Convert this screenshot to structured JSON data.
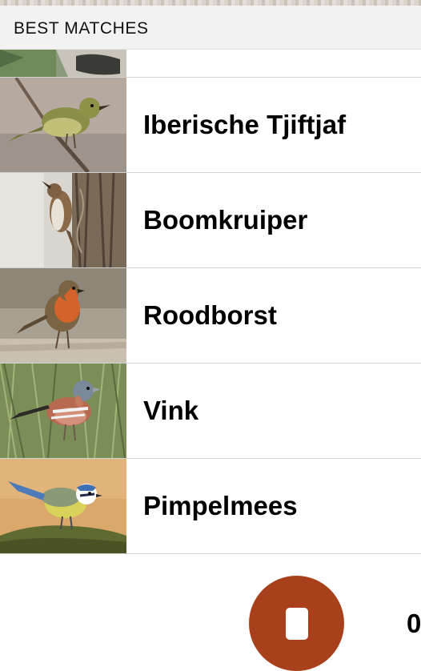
{
  "section_header": {
    "title": "BEST MATCHES"
  },
  "matches": [
    {
      "name": "",
      "photo_icon": "bird-photo-partial"
    },
    {
      "name": "Iberische Tjiftjaf",
      "photo_icon": "iberian-chiffchaff-photo"
    },
    {
      "name": "Boomkruiper",
      "photo_icon": "treecreeper-photo"
    },
    {
      "name": "Roodborst",
      "photo_icon": "robin-photo"
    },
    {
      "name": "Vink",
      "photo_icon": "chaffinch-photo"
    },
    {
      "name": "Pimpelmees",
      "photo_icon": "blue-tit-photo"
    }
  ],
  "recorder": {
    "button_icon": "stop-icon",
    "timer_text": "0",
    "button_color": "#a9401c"
  }
}
